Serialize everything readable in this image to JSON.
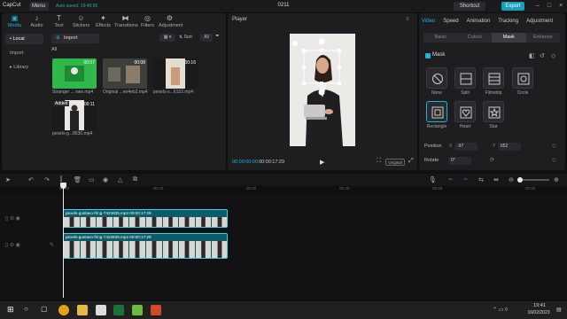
{
  "app": {
    "name": "CapCut",
    "menu_label": "Menu",
    "autosave": "Auto saved: 19:40:55",
    "project_title": "0211",
    "shortcut_label": "Shortcut",
    "export_label": "Export"
  },
  "toolbar": [
    {
      "label": "Media",
      "icon": "media-icon",
      "glyph": "▣"
    },
    {
      "label": "Audio",
      "icon": "audio-icon",
      "glyph": "♪"
    },
    {
      "label": "Text",
      "icon": "text-icon",
      "glyph": "T"
    },
    {
      "label": "Stickers",
      "icon": "sticker-icon",
      "glyph": "☺"
    },
    {
      "label": "Effects",
      "icon": "effects-icon",
      "glyph": "✦"
    },
    {
      "label": "Transitions",
      "icon": "transitions-icon",
      "glyph": "⧓"
    },
    {
      "label": "Filters",
      "icon": "filters-icon",
      "glyph": "◎"
    },
    {
      "label": "Adjustment",
      "icon": "adjustment-icon",
      "glyph": "⚙"
    }
  ],
  "sidebar": [
    {
      "label": "• Local"
    },
    {
      "label": "Import"
    },
    {
      "label": "▸ Library"
    }
  ],
  "media": {
    "import_label": "Import",
    "sort_label": "Sort",
    "all_label": "All",
    "all_heading": "All",
    "clips": [
      {
        "name": "Stranger ... swe.mp4",
        "duration": "00:07"
      },
      {
        "name": "Original ...ee4eb2.mp4",
        "duration": "00:08"
      },
      {
        "name": "pexels-s...6152.mp4",
        "duration": "00:16"
      },
      {
        "name": "pexels-g...8630.mp4",
        "duration": "00:11",
        "badge": "Added"
      }
    ]
  },
  "player": {
    "title": "Player",
    "current_time": "00:00:00:00",
    "total_time": "00:00:17:29",
    "original_label": "Original"
  },
  "inspector": {
    "tabs": [
      "Video",
      "Speed",
      "Animation",
      "Tracking",
      "Adjustment"
    ],
    "subtabs": [
      "Basic",
      "Cutout",
      "Mask",
      "Enhance"
    ],
    "mask_label": "Mask",
    "shapes": [
      "None",
      "Split",
      "Filmstrip",
      "Circle",
      "Rectangle",
      "Heart",
      "Star"
    ],
    "position_label": "Position",
    "pos_x": "-97",
    "pos_y": "652",
    "rotate_label": "Rotate",
    "rotate_value": "0°"
  },
  "timeline": {
    "ticks": [
      "00:00",
      "00:10",
      "00:20",
      "00:30",
      "00:40",
      "00:50"
    ],
    "tracks": [
      {
        "label": "pexels-gustavo-fring-7423635.mp4  00:00:17:29"
      },
      {
        "label": "pexels-gustavo-fring-7423636.mp4  00:00:17:29"
      }
    ]
  },
  "taskbar": {
    "time": "19:41",
    "date": "16/02/2023"
  }
}
